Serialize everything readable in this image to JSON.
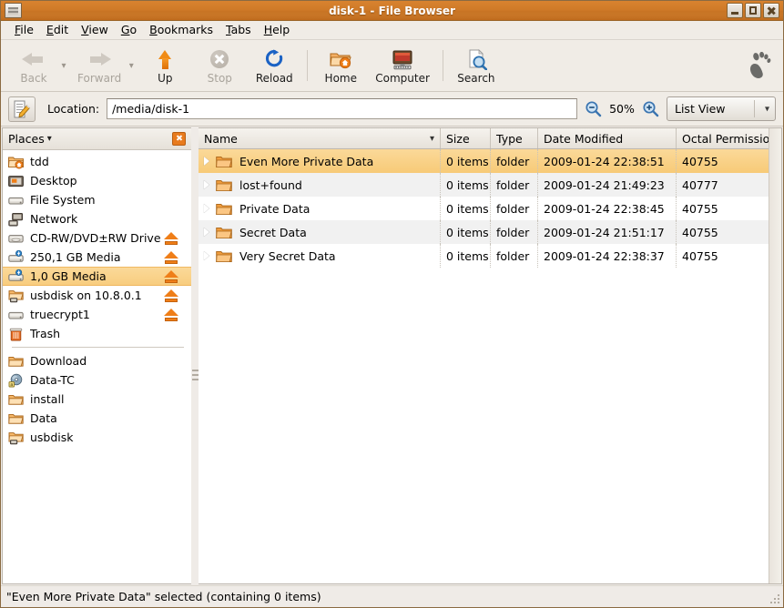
{
  "window": {
    "title": "disk-1 - File Browser",
    "icon": "file-cabinet-icon",
    "minimize_label": "Minimize",
    "maximize_label": "Maximize",
    "close_label": "Close"
  },
  "menubar": {
    "items": [
      {
        "label": "File",
        "mnemonic": "F"
      },
      {
        "label": "Edit",
        "mnemonic": "E"
      },
      {
        "label": "View",
        "mnemonic": "V"
      },
      {
        "label": "Go",
        "mnemonic": "G"
      },
      {
        "label": "Bookmarks",
        "mnemonic": "B"
      },
      {
        "label": "Tabs",
        "mnemonic": "T"
      },
      {
        "label": "Help",
        "mnemonic": "H"
      }
    ]
  },
  "toolbar": {
    "back_label": "Back",
    "forward_label": "Forward",
    "up_label": "Up",
    "stop_label": "Stop",
    "reload_label": "Reload",
    "home_label": "Home",
    "computer_label": "Computer",
    "search_label": "Search",
    "gnome_logo": "gnome-foot-icon"
  },
  "location": {
    "toggle_icon": "edit-location-icon",
    "label": "Location:",
    "value": "/media/disk-1",
    "placeholder": "",
    "zoom_out_icon": "zoom-out-icon",
    "zoom_level": "50%",
    "zoom_in_icon": "zoom-in-icon",
    "view_selected": "List View"
  },
  "sidebar": {
    "header_title": "Places",
    "header_chevron": "chevron-down-icon",
    "close_icon": "close-icon",
    "items": [
      {
        "label": "tdd",
        "icon": "home-folder-icon",
        "eject": false,
        "selected": false
      },
      {
        "label": "Desktop",
        "icon": "desktop-icon",
        "eject": false,
        "selected": false
      },
      {
        "label": "File System",
        "icon": "harddisk-icon",
        "eject": false,
        "selected": false
      },
      {
        "label": "Network",
        "icon": "network-icon",
        "eject": false,
        "selected": false
      },
      {
        "label": "CD-RW/DVD±RW Drive",
        "icon": "optical-drive-icon",
        "eject": true,
        "selected": false
      },
      {
        "label": "250,1 GB Media",
        "icon": "usb-drive-icon",
        "eject": true,
        "selected": false
      },
      {
        "label": "1,0 GB Media",
        "icon": "usb-drive-icon",
        "eject": true,
        "selected": true
      },
      {
        "label": "usbdisk on 10.8.0.1",
        "icon": "network-share-icon",
        "eject": true,
        "selected": false
      },
      {
        "label": "truecrypt1",
        "icon": "harddisk-icon",
        "eject": true,
        "selected": false
      },
      {
        "label": "Trash",
        "icon": "trash-icon",
        "eject": false,
        "selected": false
      }
    ],
    "bookmarks": [
      {
        "label": "Download",
        "icon": "folder-icon"
      },
      {
        "label": "Data-TC",
        "icon": "volume-disc-icon"
      },
      {
        "label": "install",
        "icon": "folder-icon"
      },
      {
        "label": "Data",
        "icon": "folder-icon"
      },
      {
        "label": "usbdisk",
        "icon": "network-share-icon"
      }
    ]
  },
  "filelist": {
    "columns": [
      {
        "key": "name",
        "label": "Name",
        "sorted": true,
        "sort_icon": "chevron-down-icon"
      },
      {
        "key": "size",
        "label": "Size",
        "sorted": false
      },
      {
        "key": "type",
        "label": "Type",
        "sorted": false
      },
      {
        "key": "date",
        "label": "Date Modified",
        "sorted": false
      },
      {
        "key": "perm",
        "label": "Octal Permissions",
        "sorted": false
      }
    ],
    "rows": [
      {
        "name": "Even More Private Data",
        "size": "0 items",
        "type": "folder",
        "date": "2009-01-24 22:38:51",
        "perm": "40755",
        "selected": true
      },
      {
        "name": "lost+found",
        "size": "0 items",
        "type": "folder",
        "date": "2009-01-24 21:49:23",
        "perm": "40777",
        "selected": false
      },
      {
        "name": "Private Data",
        "size": "0 items",
        "type": "folder",
        "date": "2009-01-24 22:38:45",
        "perm": "40755",
        "selected": false
      },
      {
        "name": "Secret Data",
        "size": "0 items",
        "type": "folder",
        "date": "2009-01-24 21:51:17",
        "perm": "40755",
        "selected": false
      },
      {
        "name": "Very Secret Data",
        "size": "0 items",
        "type": "folder",
        "date": "2009-01-24 22:38:37",
        "perm": "40755",
        "selected": false
      }
    ]
  },
  "statusbar": {
    "text": "\"Even More Private Data\" selected (containing 0 items)"
  },
  "colors": {
    "titlebar": "#cf7a28",
    "selection": "#f8cd7f",
    "accent_orange": "#ef7e18",
    "chrome": "#f0ece6"
  }
}
